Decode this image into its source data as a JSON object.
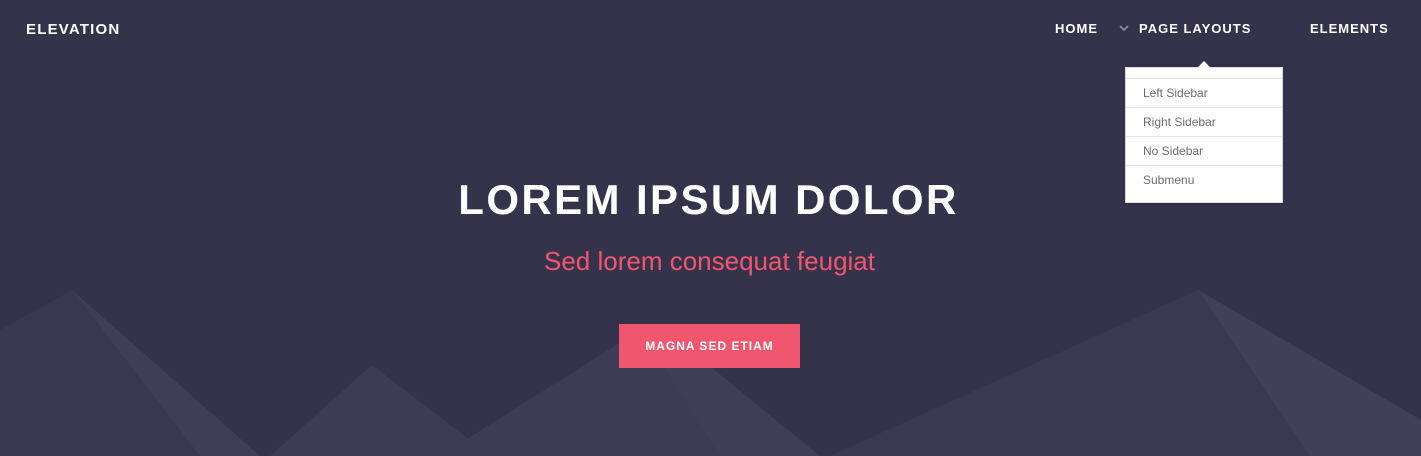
{
  "colors": {
    "background": "#35334b",
    "mountain_light": "#403d56",
    "mountain_mid": "#3a3850",
    "accent": "#f0576f",
    "text": "#ffffff",
    "dropdown_text": "#6b6b72"
  },
  "header": {
    "logo": "ELEVATION",
    "nav": [
      {
        "label": "HOME"
      },
      {
        "label": "PAGE LAYOUTS",
        "icon": "chevron-down-icon"
      },
      {
        "label": "ELEMENTS"
      }
    ]
  },
  "dropdown": {
    "items": [
      {
        "label": "Left Sidebar"
      },
      {
        "label": "Right Sidebar"
      },
      {
        "label": "No Sidebar"
      },
      {
        "label": "Submenu"
      }
    ]
  },
  "hero": {
    "title": "LOREM IPSUM DOLOR",
    "subtitle": "Sed lorem consequat feugiat",
    "button_label": "MAGNA SED ETIAM"
  }
}
